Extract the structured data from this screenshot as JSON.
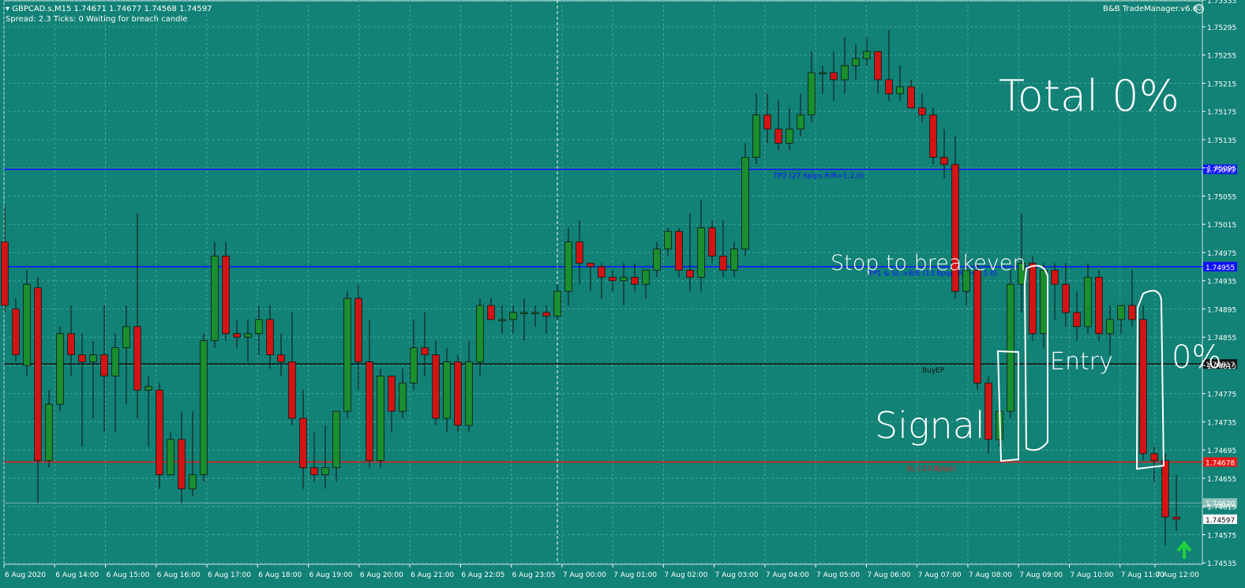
{
  "header": {
    "symbol_line": "GBPCAD.s,M15  1.74671 1.74677 1.74568 1.74597",
    "status_line": "Spread: 2.3   Ticks: 0   Waiting for breach candle",
    "brand": "B&B TradeManager.v6.6"
  },
  "colors": {
    "background": "#128176",
    "grid": "#4aa69c",
    "bull": "#1a8f2e",
    "bear": "#d41414",
    "tp_line": "#1010ff",
    "sl_line": "#e81818",
    "entry_line": "#111111",
    "axis_text": "#ffffff",
    "annotation": "#ffffff"
  },
  "annotations": {
    "total": "Total 0%",
    "stop": "Stop to breakeven",
    "entry": "Entry",
    "pct": "0%",
    "signal": "Signal"
  },
  "chart_data": {
    "type": "candlestick",
    "symbol": "GBPCAD.s",
    "timeframe": "M15",
    "ylim": [
      1.74533,
      1.75333
    ],
    "y_ticks": [
      "1.75333",
      "1.75295",
      "1.75255",
      "1.75215",
      "1.75175",
      "1.75135",
      "1.75095",
      "1.75055",
      "1.75015",
      "1.74975",
      "1.74935",
      "1.74895",
      "1.74855",
      "1.74815",
      "1.74775",
      "1.74735",
      "1.74695",
      "1.74655",
      "1.74615",
      "1.74575",
      "1.74535"
    ],
    "x_labels": [
      "6 Aug 2020",
      "6 Aug 14:00",
      "6 Aug 15:00",
      "6 Aug 16:00",
      "6 Aug 17:00",
      "6 Aug 18:00",
      "6 Aug 19:00",
      "6 Aug 20:00",
      "6 Aug 21:00",
      "6 Aug 22:05",
      "6 Aug 23:05",
      "7 Aug 00:00",
      "7 Aug 01:00",
      "7 Aug 02:00",
      "7 Aug 03:00",
      "7 Aug 04:00",
      "7 Aug 05:00",
      "7 Aug 06:00",
      "7 Aug 07:00",
      "7 Aug 08:00",
      "7 Aug 09:00",
      "7 Aug 10:00",
      "7 Aug 11:00",
      "7 Aug 12:00"
    ],
    "levels": [
      {
        "name": "TP2",
        "price": 1.75093,
        "label": "TP2 (27.6pips R/R=1:2.0)",
        "tag": "1.75093",
        "color": "#1010ff"
      },
      {
        "name": "TP1",
        "price": 1.74955,
        "label": "TP1 & SL->B/E (13.8pips R/R=1:1.0)",
        "tag": "1.74955",
        "color": "#1010ff"
      },
      {
        "name": "BuyEP",
        "price": 1.74817,
        "label": "BuyEP",
        "tag": "1.74817",
        "color": "#111111"
      },
      {
        "name": "SL",
        "price": 1.74678,
        "label": "SL (-13.8pips)",
        "tag": "1.74678",
        "color": "#e81818"
      }
    ],
    "extra_tags": [
      {
        "price": 1.7462,
        "tag": "1.74620"
      },
      {
        "price": 1.74597,
        "tag": "1.74597"
      }
    ],
    "candles": [
      [
        1.7499,
        1.7504,
        1.7489,
        1.749
      ],
      [
        1.74895,
        1.7491,
        1.7482,
        1.7483
      ],
      [
        1.74815,
        1.7495,
        1.748,
        1.7493
      ],
      [
        1.74925,
        1.7494,
        1.7462,
        1.7468
      ],
      [
        1.7468,
        1.7478,
        1.7467,
        1.7476
      ],
      [
        1.7476,
        1.7487,
        1.7475,
        1.7486
      ],
      [
        1.7486,
        1.749,
        1.748,
        1.7483
      ],
      [
        1.7483,
        1.7486,
        1.747,
        1.7482
      ],
      [
        1.7482,
        1.7485,
        1.7474,
        1.7483
      ],
      [
        1.7483,
        1.749,
        1.7472,
        1.748
      ],
      [
        1.748,
        1.7486,
        1.7472,
        1.7484
      ],
      [
        1.7484,
        1.749,
        1.7476,
        1.7487
      ],
      [
        1.7487,
        1.7503,
        1.7474,
        1.7478
      ],
      [
        1.7478,
        1.748,
        1.747,
        1.74785
      ],
      [
        1.7478,
        1.7479,
        1.7464,
        1.7466
      ],
      [
        1.7466,
        1.7472,
        1.7466,
        1.7471
      ],
      [
        1.7471,
        1.7475,
        1.7462,
        1.7464
      ],
      [
        1.7464,
        1.7475,
        1.7463,
        1.7466
      ],
      [
        1.7466,
        1.7486,
        1.7465,
        1.7485
      ],
      [
        1.7485,
        1.7499,
        1.7484,
        1.7497
      ],
      [
        1.7497,
        1.7499,
        1.7485,
        1.7486
      ],
      [
        1.7486,
        1.7488,
        1.7484,
        1.74855
      ],
      [
        1.74855,
        1.7488,
        1.7482,
        1.7486
      ],
      [
        1.7486,
        1.749,
        1.7483,
        1.7488
      ],
      [
        1.7488,
        1.749,
        1.7481,
        1.7483
      ],
      [
        1.7483,
        1.7486,
        1.748,
        1.7482
      ],
      [
        1.7482,
        1.7489,
        1.7473,
        1.7474
      ],
      [
        1.7474,
        1.7478,
        1.7464,
        1.7467
      ],
      [
        1.7467,
        1.7472,
        1.7465,
        1.7466
      ],
      [
        1.7466,
        1.7473,
        1.7464,
        1.7467
      ],
      [
        1.7467,
        1.7475,
        1.7465,
        1.7475
      ],
      [
        1.7475,
        1.7492,
        1.7474,
        1.7491
      ],
      [
        1.7491,
        1.7493,
        1.7478,
        1.7482
      ],
      [
        1.7482,
        1.7488,
        1.7467,
        1.7468
      ],
      [
        1.7468,
        1.7481,
        1.7467,
        1.748
      ],
      [
        1.748,
        1.748,
        1.7472,
        1.7475
      ],
      [
        1.7475,
        1.7481,
        1.7474,
        1.7479
      ],
      [
        1.7479,
        1.7488,
        1.7478,
        1.7484
      ],
      [
        1.7484,
        1.7489,
        1.748,
        1.7483
      ],
      [
        1.7483,
        1.7485,
        1.7473,
        1.7474
      ],
      [
        1.7474,
        1.7484,
        1.7472,
        1.7482
      ],
      [
        1.7482,
        1.7483,
        1.7472,
        1.7473
      ],
      [
        1.7473,
        1.7485,
        1.7472,
        1.7482
      ],
      [
        1.7482,
        1.7491,
        1.748,
        1.749
      ],
      [
        1.749,
        1.7491,
        1.7488,
        1.7488
      ],
      [
        1.7488,
        1.749,
        1.7486,
        1.7488
      ],
      [
        1.7488,
        1.749,
        1.7486,
        1.7489
      ],
      [
        1.7489,
        1.7491,
        1.7485,
        1.7489
      ],
      [
        1.7489,
        1.749,
        1.7487,
        1.7489
      ],
      [
        1.7489,
        1.749,
        1.7486,
        1.74885
      ],
      [
        1.74885,
        1.7493,
        1.7488,
        1.7492
      ],
      [
        1.7492,
        1.7501,
        1.749,
        1.7499
      ],
      [
        1.7499,
        1.7502,
        1.7493,
        1.7496
      ],
      [
        1.7496,
        1.7496,
        1.7492,
        1.74955
      ],
      [
        1.74955,
        1.7496,
        1.7491,
        1.7494
      ],
      [
        1.7494,
        1.7495,
        1.7492,
        1.74935
      ],
      [
        1.74935,
        1.7496,
        1.749,
        1.7494
      ],
      [
        1.7494,
        1.7496,
        1.7492,
        1.7493
      ],
      [
        1.7493,
        1.7495,
        1.7491,
        1.7495
      ],
      [
        1.7495,
        1.7499,
        1.7494,
        1.7498
      ],
      [
        1.7498,
        1.7501,
        1.7497,
        1.75005
      ],
      [
        1.75005,
        1.7501,
        1.7494,
        1.7495
      ],
      [
        1.7495,
        1.7503,
        1.7492,
        1.7494
      ],
      [
        1.7494,
        1.7505,
        1.7492,
        1.7501
      ],
      [
        1.7501,
        1.7502,
        1.7496,
        1.7497
      ],
      [
        1.7497,
        1.7502,
        1.7494,
        1.7495
      ],
      [
        1.7495,
        1.7499,
        1.7494,
        1.7498
      ],
      [
        1.7498,
        1.7513,
        1.7497,
        1.7511
      ],
      [
        1.7511,
        1.752,
        1.751,
        1.7517
      ],
      [
        1.7517,
        1.752,
        1.7513,
        1.7515
      ],
      [
        1.7515,
        1.7519,
        1.7512,
        1.7513
      ],
      [
        1.7513,
        1.7518,
        1.7512,
        1.7515
      ],
      [
        1.7515,
        1.752,
        1.7514,
        1.7517
      ],
      [
        1.7517,
        1.7526,
        1.7516,
        1.7523
      ],
      [
        1.7523,
        1.7524,
        1.752,
        1.7523
      ],
      [
        1.7523,
        1.7526,
        1.7519,
        1.7522
      ],
      [
        1.7522,
        1.7528,
        1.752,
        1.7524
      ],
      [
        1.7524,
        1.7527,
        1.7522,
        1.7525
      ],
      [
        1.7525,
        1.7528,
        1.7524,
        1.7526
      ],
      [
        1.7526,
        1.7526,
        1.752,
        1.7522
      ],
      [
        1.7522,
        1.7529,
        1.7519,
        1.752
      ],
      [
        1.752,
        1.7524,
        1.7519,
        1.7521
      ],
      [
        1.7521,
        1.7522,
        1.7518,
        1.7518
      ],
      [
        1.7518,
        1.752,
        1.7516,
        1.7517
      ],
      [
        1.7517,
        1.7518,
        1.751,
        1.7511
      ],
      [
        1.7511,
        1.7515,
        1.7508,
        1.751
      ],
      [
        1.751,
        1.7514,
        1.7491,
        1.7492
      ],
      [
        1.7492,
        1.7497,
        1.749,
        1.7495
      ],
      [
        1.7495,
        1.7496,
        1.7478,
        1.7479
      ],
      [
        1.7479,
        1.748,
        1.7469,
        1.7471
      ],
      [
        1.7471,
        1.7478,
        1.747,
        1.7475
      ],
      [
        1.7475,
        1.7495,
        1.7474,
        1.7493
      ],
      [
        1.7493,
        1.7503,
        1.7489,
        1.7496
      ],
      [
        1.7496,
        1.7497,
        1.7485,
        1.7486
      ],
      [
        1.7486,
        1.7496,
        1.7484,
        1.7495
      ],
      [
        1.7495,
        1.7496,
        1.7488,
        1.7493
      ],
      [
        1.7493,
        1.7496,
        1.7487,
        1.7489
      ],
      [
        1.7489,
        1.7492,
        1.7485,
        1.7487
      ],
      [
        1.7487,
        1.7496,
        1.7486,
        1.7494
      ],
      [
        1.7494,
        1.7495,
        1.7485,
        1.7486
      ],
      [
        1.7486,
        1.749,
        1.7483,
        1.7488
      ],
      [
        1.7488,
        1.749,
        1.7486,
        1.749
      ],
      [
        1.749,
        1.7495,
        1.7487,
        1.7488
      ],
      [
        1.7488,
        1.749,
        1.7468,
        1.7469
      ],
      [
        1.7469,
        1.747,
        1.7465,
        1.7468
      ],
      [
        1.7468,
        1.7469,
        1.7456,
        1.746
      ],
      [
        1.746,
        1.7466,
        1.7458,
        1.74597
      ]
    ]
  }
}
